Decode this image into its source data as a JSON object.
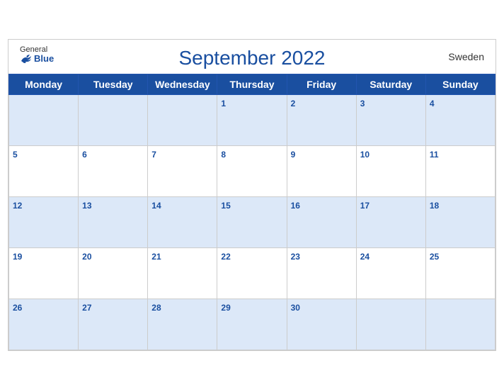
{
  "header": {
    "title": "September 2022",
    "country": "Sweden",
    "logo_general": "General",
    "logo_blue": "Blue"
  },
  "weekdays": [
    "Monday",
    "Tuesday",
    "Wednesday",
    "Thursday",
    "Friday",
    "Saturday",
    "Sunday"
  ],
  "weeks": [
    [
      null,
      null,
      null,
      1,
      2,
      3,
      4
    ],
    [
      5,
      6,
      7,
      8,
      9,
      10,
      11
    ],
    [
      12,
      13,
      14,
      15,
      16,
      17,
      18
    ],
    [
      19,
      20,
      21,
      22,
      23,
      24,
      25
    ],
    [
      26,
      27,
      28,
      29,
      30,
      null,
      null
    ]
  ]
}
